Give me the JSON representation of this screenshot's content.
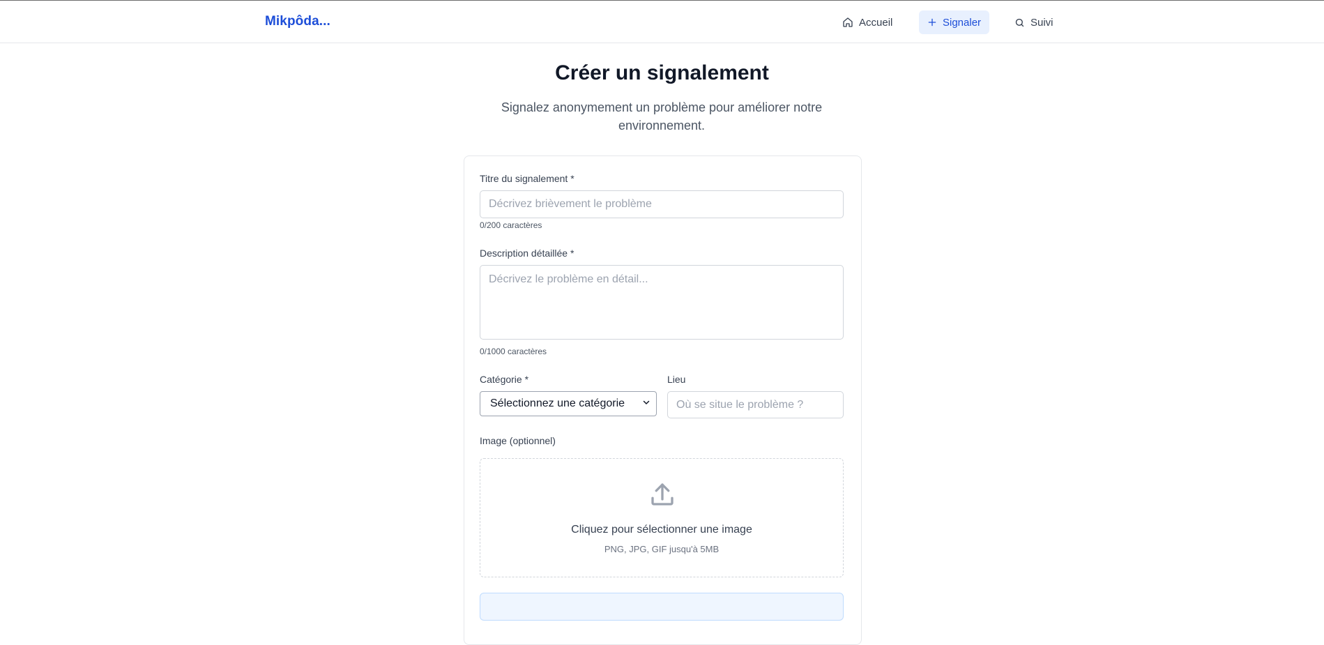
{
  "brand": "Mikpôda...",
  "nav": {
    "home_label": "Accueil",
    "report_label": "Signaler",
    "track_label": "Suivi"
  },
  "page": {
    "title": "Créer un signalement",
    "subtitle": "Signalez anonymement un problème pour améliorer notre environnement."
  },
  "form": {
    "title_label": "Titre du signalement *",
    "title_placeholder": "Décrivez brièvement le problème",
    "title_value": "",
    "title_counter": "0/200 caractères",
    "description_label": "Description détaillée *",
    "description_placeholder": "Décrivez le problème en détail...",
    "description_value": "",
    "description_counter": "0/1000 caractères",
    "category_label": "Catégorie *",
    "category_selected": "Sélectionnez une catégorie",
    "location_label": "Lieu",
    "location_placeholder": "Où se situe le problème ?",
    "location_value": "",
    "image_label": "Image (optionnel)",
    "upload_text": "Cliquez pour sélectionner une image",
    "upload_hint": "PNG, JPG, GIF jusqu'à 5MB"
  },
  "colors": {
    "brand": "#1d4ed8",
    "active_nav_bg": "#e8f0fe",
    "muted_text": "#4b5563"
  },
  "icons": {
    "home": "home-icon",
    "report": "plus-icon",
    "track": "search-icon",
    "select": "chevron-down-icon",
    "upload": "upload-icon"
  }
}
